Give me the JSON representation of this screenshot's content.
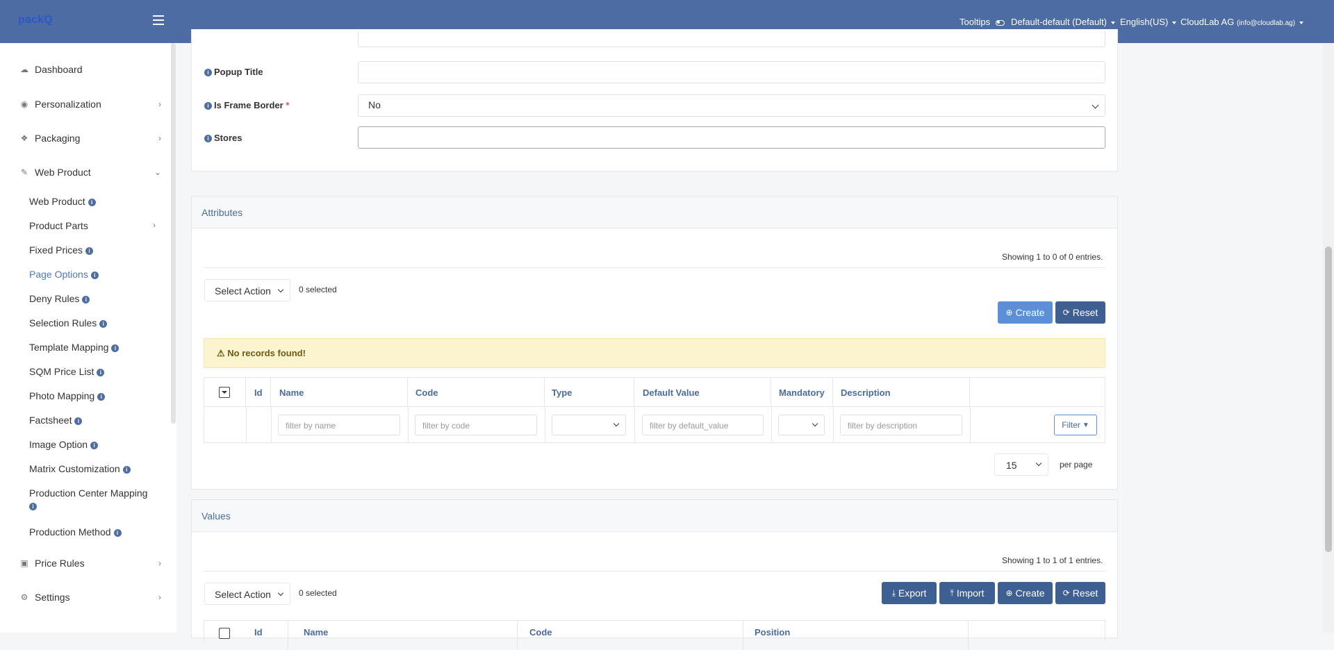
{
  "topbar": {
    "brand": "packQ",
    "tooltips": "Tooltips",
    "store": "Default-default (Default)",
    "language": "English(US)",
    "account": "CloudLab AG",
    "account_email": "(info@cloudlab.ag)"
  },
  "sidebar": {
    "main": [
      {
        "label": "Dashboard",
        "icon": "cloud-icon"
      },
      {
        "label": "Personalization",
        "icon": "eye-icon"
      },
      {
        "label": "Packaging",
        "icon": "dropbox-icon"
      },
      {
        "label": "Web Product",
        "icon": "magic-wand-icon"
      },
      {
        "label": "Price Rules",
        "icon": "money-icon"
      },
      {
        "label": "Settings",
        "icon": "cogs-icon"
      }
    ],
    "web_product_items": [
      {
        "label": "Web Product"
      },
      {
        "label": "Product Parts"
      },
      {
        "label": "Fixed Prices"
      },
      {
        "label": "Page Options"
      },
      {
        "label": "Deny Rules"
      },
      {
        "label": "Selection Rules"
      },
      {
        "label": "Template Mapping"
      },
      {
        "label": "SQM Price List"
      },
      {
        "label": "Photo Mapping"
      },
      {
        "label": "Factsheet"
      },
      {
        "label": "Image Option"
      },
      {
        "label": "Matrix Customization"
      },
      {
        "label": "Production Center Mapping"
      },
      {
        "label": "Production Method"
      }
    ]
  },
  "form": {
    "popup_title_label": "Popup Title",
    "popup_title_value": "",
    "frame_border_label": "Is Frame Border",
    "frame_border_required": "*",
    "frame_border_value": "No",
    "stores_label": "Stores",
    "stores_value": ""
  },
  "attributes": {
    "title": "Attributes",
    "showing": "Showing 1 to 0 of 0 entries.",
    "select_action": "Select Action",
    "selected": "0 selected",
    "create": "Create",
    "reset": "Reset",
    "alert": "No records found!",
    "columns": [
      "Id",
      "Name",
      "Code",
      "Type",
      "Default Value",
      "Mandatory",
      "Description"
    ],
    "filters": {
      "name": "filter by name",
      "code": "filter by code",
      "default_value": "filter by default_value",
      "description": "filter by description"
    },
    "filter_button": "Filter",
    "per_page_value": "15",
    "per_page_label": "per page"
  },
  "values": {
    "title": "Values",
    "showing": "Showing 1 to 1 of 1 entries.",
    "select_action": "Select Action",
    "selected": "0 selected",
    "export": "Export",
    "import": "Import",
    "create": "Create",
    "reset": "Reset",
    "columns": [
      "Id",
      "Name",
      "Code",
      "Position"
    ]
  }
}
